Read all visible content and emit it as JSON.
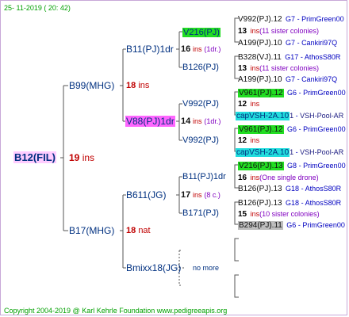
{
  "header": {
    "timestamp": "25- 11-2019 ( 20: 42)"
  },
  "footer": {
    "copyright": "Copyright 2004-2019 @ Karl Kehrle Foundation   www.pedigreeapis.org"
  },
  "colors": {
    "magenta": "#ff66ff",
    "green": "#22dd22",
    "cyan": "#22dddd",
    "grey_badge": "#bdbdbd",
    "line": "#555555",
    "accent_red": "#c00000",
    "lineage_blue": "#0000c0"
  },
  "root": {
    "name": "B12(FIL)",
    "num": "19",
    "suffix": "ins"
  },
  "gen1": [
    {
      "name": "B99(MHG)",
      "num": "18",
      "suffix": "ins"
    },
    {
      "name": "B17(MHG)",
      "num": "18",
      "suffix": "nat"
    }
  ],
  "gen2": [
    {
      "name": "B11(PJ)1dr",
      "num": "16",
      "suffix": "ins",
      "note": "(1dr.)"
    },
    {
      "name": "V88(PJ)1dr",
      "num": "14",
      "suffix": "ins",
      "note": "(1dr.)"
    },
    {
      "name": "B611(JG)",
      "num": "17",
      "suffix": "ins",
      "note": "(8 c.)"
    },
    {
      "name": "Bmixx18(JG)",
      "num": "",
      "suffix": "no more",
      "note": ""
    }
  ],
  "gen3": [
    {
      "name": "V216(PJ)"
    },
    {
      "name": "B126(PJ)"
    },
    {
      "name": "V992(PJ)"
    },
    {
      "name": "V992(PJ)"
    },
    {
      "name": "B11(PJ)1dr"
    },
    {
      "name": "B171(PJ)"
    }
  ],
  "gen4": [
    {
      "name": "V992(PJ).12",
      "gen": "G7",
      "lineage": "PrimGreen00"
    },
    {
      "num": "13",
      "suffix": "ins",
      "note": "(11 sister colonies)"
    },
    {
      "name": "A199(PJ).10",
      "gen": "G7",
      "lineage": "Cankiri97Q"
    },
    {
      "name": "B328(VJ).11",
      "gen": "G17",
      "lineage": "AthosS80R"
    },
    {
      "num": "13",
      "suffix": "ins",
      "note": "(11 sister colonies)"
    },
    {
      "name": "A199(PJ).10",
      "gen": "G7",
      "lineage": "Cankiri97Q"
    },
    {
      "name": "V961(PJ).12",
      "gen": "G6",
      "lineage": "PrimGreen00"
    },
    {
      "num": "12",
      "suffix": "ins"
    },
    {
      "name": "capVSH-2A.10",
      "gen": "1",
      "lineage": "VSH-Pool-AR"
    },
    {
      "name": "V961(PJ).12",
      "gen": "G6",
      "lineage": "PrimGreen00"
    },
    {
      "num": "12",
      "suffix": "ins"
    },
    {
      "name": "capVSH-2A.10",
      "gen": "1",
      "lineage": "VSH-Pool-AR"
    },
    {
      "name": "V216(PJ).13",
      "gen": "G8",
      "lineage": "PrimGreen00"
    },
    {
      "num": "16",
      "suffix": "ins",
      "note": "(One single drone)"
    },
    {
      "name": "B126(PJ).13",
      "gen": "G18",
      "lineage": "AthosS80R"
    },
    {
      "name": "B126(PJ).13",
      "gen": "G18",
      "lineage": "AthosS80R"
    },
    {
      "num": "15",
      "suffix": "ins",
      "note": "(10 sister colonies)"
    },
    {
      "name": "B294(PJ).11",
      "gen": "G6",
      "lineage": "PrimGreen00"
    }
  ]
}
